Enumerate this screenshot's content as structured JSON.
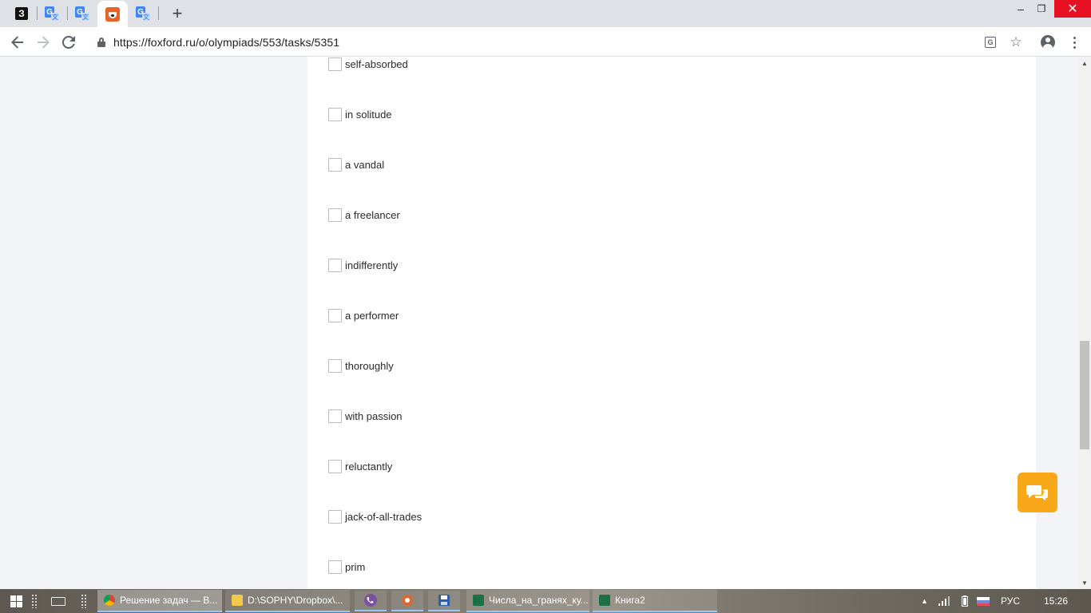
{
  "browser": {
    "tabs": [
      {
        "icon": "zen-icon",
        "active": false
      },
      {
        "icon": "google-translate-icon",
        "active": false
      },
      {
        "icon": "google-translate-icon",
        "active": false
      },
      {
        "icon": "foxford-icon",
        "active": true
      },
      {
        "icon": "google-translate-icon",
        "active": false
      }
    ],
    "url": "https://foxford.ru/o/olympiads/553/tasks/5351",
    "new_tab_glyph": "+",
    "controls": {
      "minimize": "–",
      "restore": "❐",
      "close": "✕"
    }
  },
  "task": {
    "options": [
      "self-absorbed",
      "in solitude",
      "a vandal",
      "a freelancer",
      "indifferently",
      "a performer",
      "thoroughly",
      "with passion",
      "reluctantly",
      "jack-of-all-trades",
      "prim"
    ]
  },
  "taskbar": {
    "tasks": [
      {
        "label": "Решение задач — В...",
        "icon": "chrome-icon",
        "active": true
      },
      {
        "label": "D:\\SOPHY\\Dropbox\\...",
        "icon": "folder-icon",
        "active": false
      },
      {
        "label": "Числа_на_гранях_ку...",
        "icon": "excel-icon",
        "active": false
      },
      {
        "label": "Книга2",
        "icon": "excel-icon",
        "active": false
      }
    ],
    "language": "РУС",
    "time": "15:26"
  },
  "colors": {
    "page_bg": "#f3f4f7",
    "card_bg": "#ffffff",
    "chat_button": "#f9a81a",
    "close_button": "#e81123"
  }
}
